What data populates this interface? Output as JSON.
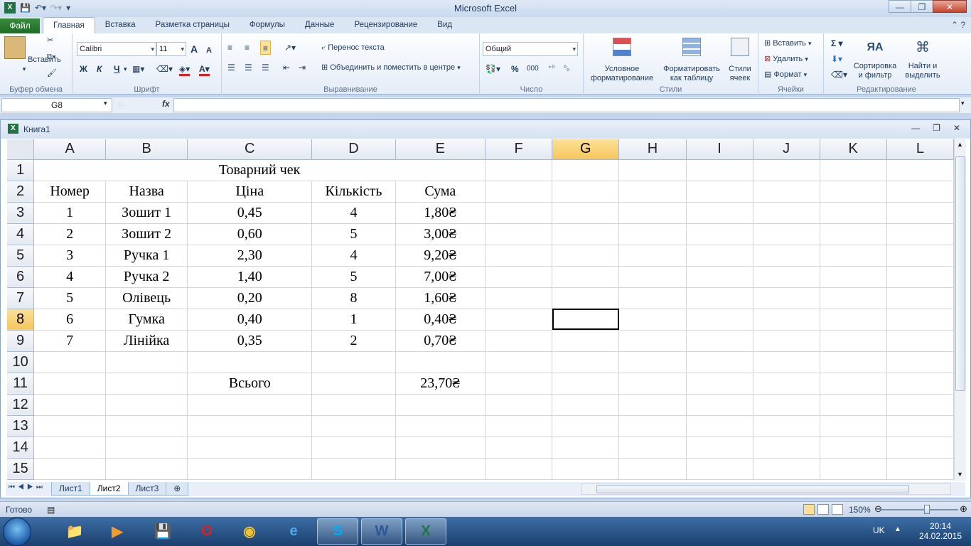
{
  "window": {
    "title": "Microsoft Excel"
  },
  "ribbon_tabs": {
    "file": "Файл",
    "items": [
      "Главная",
      "Вставка",
      "Разметка страницы",
      "Формулы",
      "Данные",
      "Рецензирование",
      "Вид"
    ],
    "active": "Главная"
  },
  "ribbon": {
    "clipboard": {
      "paste": "Вставить",
      "label": "Буфер обмена"
    },
    "font": {
      "name": "Calibri",
      "size": "11",
      "bold": "Ж",
      "italic": "К",
      "underline": "Ч",
      "grow": "A",
      "shrink": "A",
      "label": "Шрифт"
    },
    "alignment": {
      "wrap": "Перенос текста",
      "merge": "Объединить и поместить в центре",
      "label": "Выравнивание"
    },
    "number": {
      "format": "Общий",
      "percent": "%",
      "thousands": "000",
      "label": "Число"
    },
    "styles": {
      "conditional_line1": "Условное",
      "conditional_line2": "форматирование",
      "table_line1": "Форматировать",
      "table_line2": "как таблицу",
      "cell_line1": "Стили",
      "cell_line2": "ячеек",
      "label": "Стили"
    },
    "cells": {
      "insert": "Вставить",
      "delete": "Удалить",
      "format": "Формат",
      "label": "Ячейки"
    },
    "editing": {
      "sum": "Σ",
      "sort_line1": "Сортировка",
      "sort_line2": "и фильтр",
      "find_line1": "Найти и",
      "find_line2": "выделить",
      "label": "Редактирование"
    }
  },
  "formula_bar": {
    "name_box": "G8",
    "fx": "fx",
    "value": ""
  },
  "workbook": {
    "title": "Книга1"
  },
  "sheet": {
    "columns": [
      "A",
      "B",
      "C",
      "D",
      "E",
      "F",
      "G",
      "H",
      "I",
      "J",
      "K",
      "L"
    ],
    "selected_column": "G",
    "selected_row": "8",
    "rows": [
      {
        "num": "1",
        "title": "Товарний чек"
      },
      {
        "num": "2",
        "cells": [
          "Номер",
          "Назва",
          "Ціна",
          "Кількість",
          "Сума"
        ]
      },
      {
        "num": "3",
        "cells": [
          "1",
          "Зошит 1",
          "0,45",
          "4",
          "1,80₴"
        ]
      },
      {
        "num": "4",
        "cells": [
          "2",
          "Зошит 2",
          "0,60",
          "5",
          "3,00₴"
        ]
      },
      {
        "num": "5",
        "cells": [
          "3",
          "Ручка 1",
          "2,30",
          "4",
          "9,20₴"
        ]
      },
      {
        "num": "6",
        "cells": [
          "4",
          "Ручка 2",
          "1,40",
          "5",
          "7,00₴"
        ]
      },
      {
        "num": "7",
        "cells": [
          "5",
          "Олівець",
          "0,20",
          "8",
          "1,60₴"
        ]
      },
      {
        "num": "8",
        "cells": [
          "6",
          "Гумка",
          "0,40",
          "1",
          "0,40₴"
        ]
      },
      {
        "num": "9",
        "cells": [
          "7",
          "Лінійка",
          "0,35",
          "2",
          "0,70₴"
        ]
      },
      {
        "num": "10",
        "cells": [
          "",
          "",
          "",
          "",
          ""
        ]
      },
      {
        "num": "11",
        "cells": [
          "",
          "",
          "Всього",
          "",
          "23,70₴"
        ]
      },
      {
        "num": "12",
        "cells": [
          "",
          "",
          "",
          "",
          ""
        ]
      },
      {
        "num": "13",
        "cells": [
          "",
          "",
          "",
          "",
          ""
        ]
      },
      {
        "num": "14",
        "cells": [
          "",
          "",
          "",
          "",
          ""
        ]
      },
      {
        "num": "15",
        "cells": [
          "",
          "",
          "",
          "",
          ""
        ]
      }
    ]
  },
  "sheet_tabs": [
    "Лист1",
    "Лист2",
    "Лист3"
  ],
  "active_sheet": "Лист2",
  "status": {
    "ready": "Готово",
    "zoom": "150%"
  },
  "taskbar": {
    "lang": "UK",
    "time": "20:14",
    "date": "24.02.2015"
  },
  "colors": {
    "accent_green": "#217346",
    "selected_header": "#f6c65a",
    "ribbon_blue": "#dbe6f4"
  }
}
